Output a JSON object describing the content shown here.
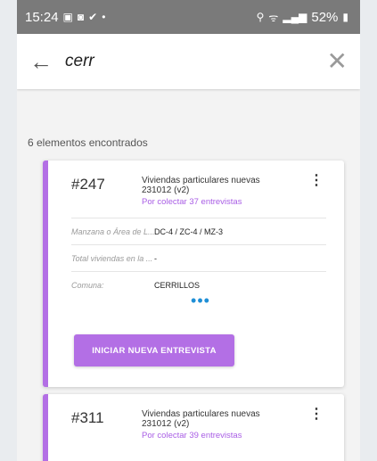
{
  "status_bar": {
    "time": "15:24",
    "left_icons": [
      "image-icon",
      "instagram-icon",
      "check-icon",
      "dot-icon"
    ],
    "right_icons": [
      "location-icon",
      "wifi-icon",
      "signal-icon",
      "battery-icon"
    ],
    "battery": "52%"
  },
  "search": {
    "value": "cerr"
  },
  "results": {
    "count_label": "6 elementos encontrados"
  },
  "cards": [
    {
      "id": "#247",
      "title": "Viviendas particulares nuevas 231012 (v2)",
      "status": "Por colectar 37 entrevistas",
      "rows": [
        {
          "label": "Manzana o Área de L...",
          "value": "DC-4 / ZC-4 / MZ-3"
        },
        {
          "label": "Total viviendas en la ...",
          "value": "-"
        },
        {
          "label": "Comuna:",
          "value": "CERRILLOS"
        }
      ],
      "more": "•••",
      "button_label": "INICIAR NUEVA ENTREVISTA"
    },
    {
      "id": "#311",
      "title": "Viviendas particulares nuevas 231012 (v2)",
      "status": "Por colectar 39 entrevistas"
    }
  ],
  "colors": {
    "accent": "#b36fe5",
    "status_bar": "#7a7a7a",
    "more_dots": "#1f8fd6"
  }
}
